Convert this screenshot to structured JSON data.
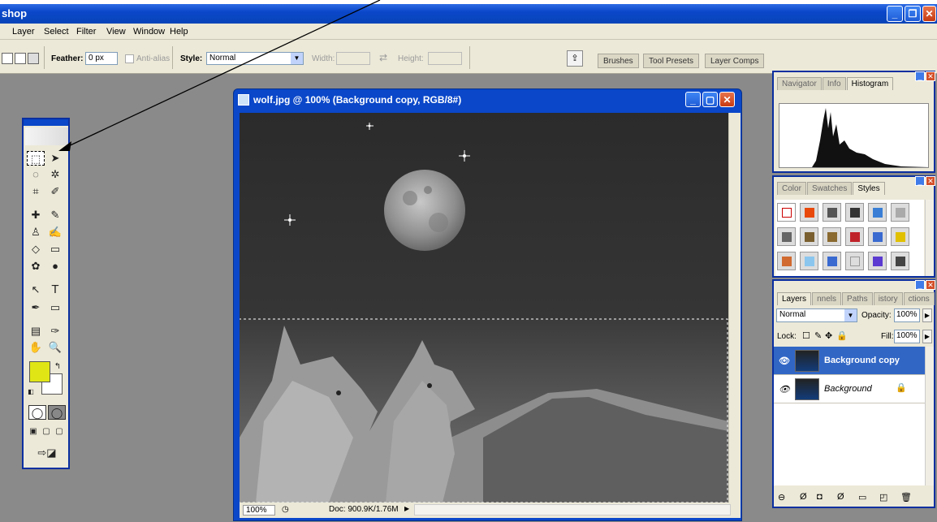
{
  "app": {
    "title": "shop"
  },
  "menu": [
    "Layer",
    "Select",
    "Filter",
    "View",
    "Window",
    "Help"
  ],
  "options": {
    "feather_label": "Feather:",
    "feather_value": "0 px",
    "antialias_label": "Anti-alias",
    "style_label": "Style:",
    "style_value": "Normal",
    "width_label": "Width:",
    "height_label": "Height:",
    "palette_tabs": [
      "Brushes",
      "Tool Presets",
      "Layer Comps"
    ]
  },
  "document": {
    "title": "wolf.jpg @ 100% (Background copy, RGB/8#)",
    "zoom": "100%",
    "doc_info": "Doc: 900.9K/1.76M"
  },
  "colors": {
    "foreground": "#e0e615",
    "background": "#ffffff",
    "titlebar": "#0a47c9"
  },
  "navigator_panel": {
    "tabs": [
      "Navigator",
      "Info",
      "Histogram"
    ],
    "active": "Histogram"
  },
  "styles_panel": {
    "tabs": [
      "Color",
      "Swatches",
      "Styles"
    ],
    "active": "Styles"
  },
  "layers_panel": {
    "tabs": [
      "Layers",
      "nnels",
      "Paths",
      "istory",
      "ctions"
    ],
    "blend_mode": "Normal",
    "opacity_label": "Opacity:",
    "opacity_value": "100%",
    "lock_label": "Lock:",
    "fill_label": "Fill:",
    "fill_value": "100%",
    "layers": [
      {
        "name": "Background copy",
        "selected": true
      },
      {
        "name": "Background",
        "selected": false,
        "locked": true
      }
    ]
  }
}
